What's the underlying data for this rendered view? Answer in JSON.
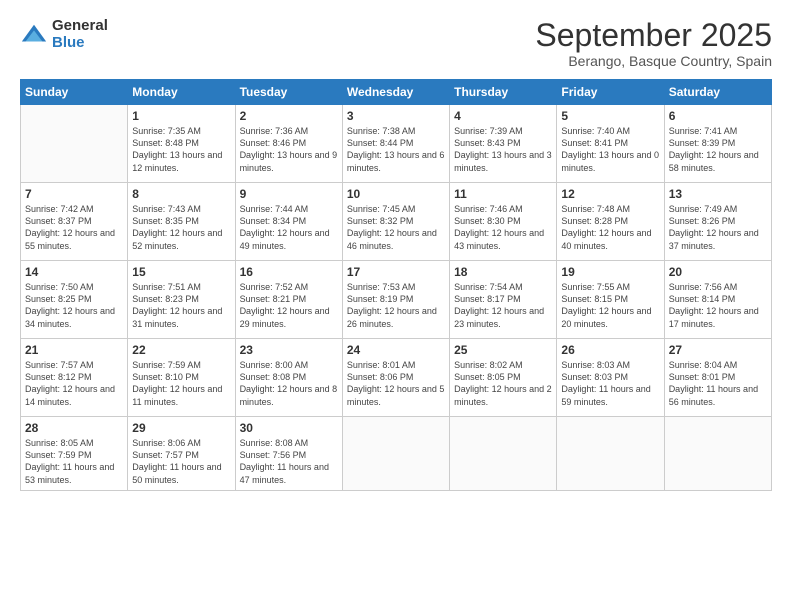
{
  "logo": {
    "general": "General",
    "blue": "Blue"
  },
  "title": "September 2025",
  "subtitle": "Berango, Basque Country, Spain",
  "days": [
    "Sunday",
    "Monday",
    "Tuesday",
    "Wednesday",
    "Thursday",
    "Friday",
    "Saturday"
  ],
  "weeks": [
    [
      {
        "num": "",
        "sunrise": "",
        "sunset": "",
        "daylight": ""
      },
      {
        "num": "1",
        "sunrise": "Sunrise: 7:35 AM",
        "sunset": "Sunset: 8:48 PM",
        "daylight": "Daylight: 13 hours and 12 minutes."
      },
      {
        "num": "2",
        "sunrise": "Sunrise: 7:36 AM",
        "sunset": "Sunset: 8:46 PM",
        "daylight": "Daylight: 13 hours and 9 minutes."
      },
      {
        "num": "3",
        "sunrise": "Sunrise: 7:38 AM",
        "sunset": "Sunset: 8:44 PM",
        "daylight": "Daylight: 13 hours and 6 minutes."
      },
      {
        "num": "4",
        "sunrise": "Sunrise: 7:39 AM",
        "sunset": "Sunset: 8:43 PM",
        "daylight": "Daylight: 13 hours and 3 minutes."
      },
      {
        "num": "5",
        "sunrise": "Sunrise: 7:40 AM",
        "sunset": "Sunset: 8:41 PM",
        "daylight": "Daylight: 13 hours and 0 minutes."
      },
      {
        "num": "6",
        "sunrise": "Sunrise: 7:41 AM",
        "sunset": "Sunset: 8:39 PM",
        "daylight": "Daylight: 12 hours and 58 minutes."
      }
    ],
    [
      {
        "num": "7",
        "sunrise": "Sunrise: 7:42 AM",
        "sunset": "Sunset: 8:37 PM",
        "daylight": "Daylight: 12 hours and 55 minutes."
      },
      {
        "num": "8",
        "sunrise": "Sunrise: 7:43 AM",
        "sunset": "Sunset: 8:35 PM",
        "daylight": "Daylight: 12 hours and 52 minutes."
      },
      {
        "num": "9",
        "sunrise": "Sunrise: 7:44 AM",
        "sunset": "Sunset: 8:34 PM",
        "daylight": "Daylight: 12 hours and 49 minutes."
      },
      {
        "num": "10",
        "sunrise": "Sunrise: 7:45 AM",
        "sunset": "Sunset: 8:32 PM",
        "daylight": "Daylight: 12 hours and 46 minutes."
      },
      {
        "num": "11",
        "sunrise": "Sunrise: 7:46 AM",
        "sunset": "Sunset: 8:30 PM",
        "daylight": "Daylight: 12 hours and 43 minutes."
      },
      {
        "num": "12",
        "sunrise": "Sunrise: 7:48 AM",
        "sunset": "Sunset: 8:28 PM",
        "daylight": "Daylight: 12 hours and 40 minutes."
      },
      {
        "num": "13",
        "sunrise": "Sunrise: 7:49 AM",
        "sunset": "Sunset: 8:26 PM",
        "daylight": "Daylight: 12 hours and 37 minutes."
      }
    ],
    [
      {
        "num": "14",
        "sunrise": "Sunrise: 7:50 AM",
        "sunset": "Sunset: 8:25 PM",
        "daylight": "Daylight: 12 hours and 34 minutes."
      },
      {
        "num": "15",
        "sunrise": "Sunrise: 7:51 AM",
        "sunset": "Sunset: 8:23 PM",
        "daylight": "Daylight: 12 hours and 31 minutes."
      },
      {
        "num": "16",
        "sunrise": "Sunrise: 7:52 AM",
        "sunset": "Sunset: 8:21 PM",
        "daylight": "Daylight: 12 hours and 29 minutes."
      },
      {
        "num": "17",
        "sunrise": "Sunrise: 7:53 AM",
        "sunset": "Sunset: 8:19 PM",
        "daylight": "Daylight: 12 hours and 26 minutes."
      },
      {
        "num": "18",
        "sunrise": "Sunrise: 7:54 AM",
        "sunset": "Sunset: 8:17 PM",
        "daylight": "Daylight: 12 hours and 23 minutes."
      },
      {
        "num": "19",
        "sunrise": "Sunrise: 7:55 AM",
        "sunset": "Sunset: 8:15 PM",
        "daylight": "Daylight: 12 hours and 20 minutes."
      },
      {
        "num": "20",
        "sunrise": "Sunrise: 7:56 AM",
        "sunset": "Sunset: 8:14 PM",
        "daylight": "Daylight: 12 hours and 17 minutes."
      }
    ],
    [
      {
        "num": "21",
        "sunrise": "Sunrise: 7:57 AM",
        "sunset": "Sunset: 8:12 PM",
        "daylight": "Daylight: 12 hours and 14 minutes."
      },
      {
        "num": "22",
        "sunrise": "Sunrise: 7:59 AM",
        "sunset": "Sunset: 8:10 PM",
        "daylight": "Daylight: 12 hours and 11 minutes."
      },
      {
        "num": "23",
        "sunrise": "Sunrise: 8:00 AM",
        "sunset": "Sunset: 8:08 PM",
        "daylight": "Daylight: 12 hours and 8 minutes."
      },
      {
        "num": "24",
        "sunrise": "Sunrise: 8:01 AM",
        "sunset": "Sunset: 8:06 PM",
        "daylight": "Daylight: 12 hours and 5 minutes."
      },
      {
        "num": "25",
        "sunrise": "Sunrise: 8:02 AM",
        "sunset": "Sunset: 8:05 PM",
        "daylight": "Daylight: 12 hours and 2 minutes."
      },
      {
        "num": "26",
        "sunrise": "Sunrise: 8:03 AM",
        "sunset": "Sunset: 8:03 PM",
        "daylight": "Daylight: 11 hours and 59 minutes."
      },
      {
        "num": "27",
        "sunrise": "Sunrise: 8:04 AM",
        "sunset": "Sunset: 8:01 PM",
        "daylight": "Daylight: 11 hours and 56 minutes."
      }
    ],
    [
      {
        "num": "28",
        "sunrise": "Sunrise: 8:05 AM",
        "sunset": "Sunset: 7:59 PM",
        "daylight": "Daylight: 11 hours and 53 minutes."
      },
      {
        "num": "29",
        "sunrise": "Sunrise: 8:06 AM",
        "sunset": "Sunset: 7:57 PM",
        "daylight": "Daylight: 11 hours and 50 minutes."
      },
      {
        "num": "30",
        "sunrise": "Sunrise: 8:08 AM",
        "sunset": "Sunset: 7:56 PM",
        "daylight": "Daylight: 11 hours and 47 minutes."
      },
      {
        "num": "",
        "sunrise": "",
        "sunset": "",
        "daylight": ""
      },
      {
        "num": "",
        "sunrise": "",
        "sunset": "",
        "daylight": ""
      },
      {
        "num": "",
        "sunrise": "",
        "sunset": "",
        "daylight": ""
      },
      {
        "num": "",
        "sunrise": "",
        "sunset": "",
        "daylight": ""
      }
    ]
  ]
}
